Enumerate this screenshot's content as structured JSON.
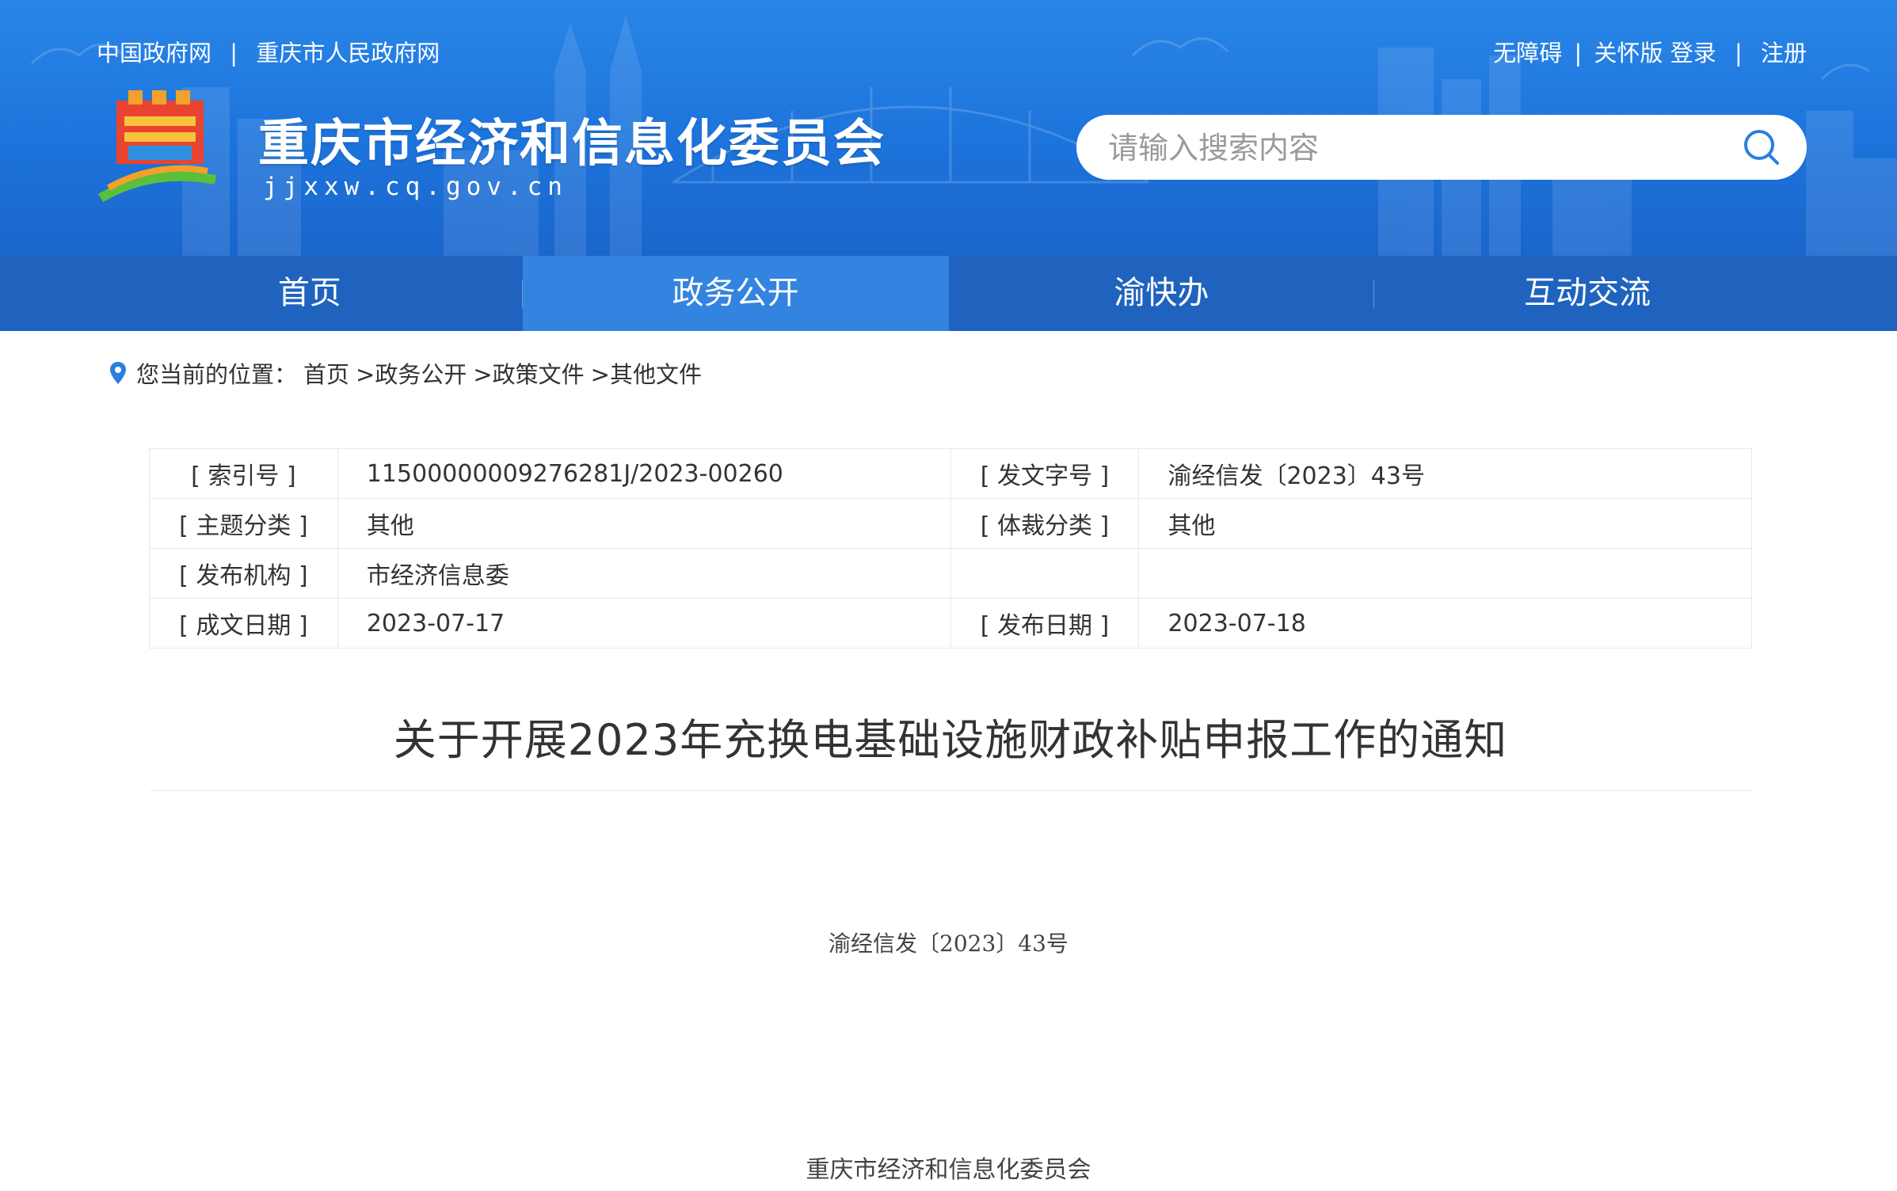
{
  "colors": {
    "header_blue": "#1d74dc",
    "nav_blue": "#1f63bf",
    "nav_active": "#3384e0",
    "text": "#333333"
  },
  "top_links": {
    "left": [
      "中国政府网",
      "重庆市人民政府网"
    ],
    "accessibility": "无障碍",
    "elder_version": "关怀版",
    "login": "登录",
    "register": "注册"
  },
  "site": {
    "title": "重庆市经济和信息化委员会",
    "domain": "jjxxw.cq.gov.cn"
  },
  "search": {
    "placeholder": "请输入搜索内容",
    "icon": "search-icon"
  },
  "nav": {
    "items": [
      "首页",
      "政务公开",
      "渝快办",
      "互动交流"
    ],
    "active_index": 1
  },
  "breadcrumb": {
    "prefix": "您当前的位置：",
    "items": [
      "首页",
      ">政务公开",
      ">政策文件",
      ">其他文件"
    ]
  },
  "meta": {
    "rows": [
      {
        "label1": "[ 索引号 ]",
        "value1": "11500000009276281J/2023-00260",
        "label2": "[ 发文字号 ]",
        "value2": "渝经信发〔2023〕43号"
      },
      {
        "label1": "[ 主题分类 ]",
        "value1": "其他",
        "label2": "[ 体裁分类 ]",
        "value2": "其他"
      },
      {
        "label1": "[ 发布机构 ]",
        "value1": "市经济信息委",
        "label2": "",
        "value2": ""
      },
      {
        "label1": "[ 成文日期 ]",
        "value1": "2023-07-17",
        "label2": "[ 发布日期 ]",
        "value2": "2023-07-18"
      }
    ]
  },
  "document": {
    "title": "关于开展2023年充换电基础设施财政补贴申报工作的通知",
    "number": "渝经信发〔2023〕43号",
    "issuer": "重庆市经济和信息化委员会"
  }
}
